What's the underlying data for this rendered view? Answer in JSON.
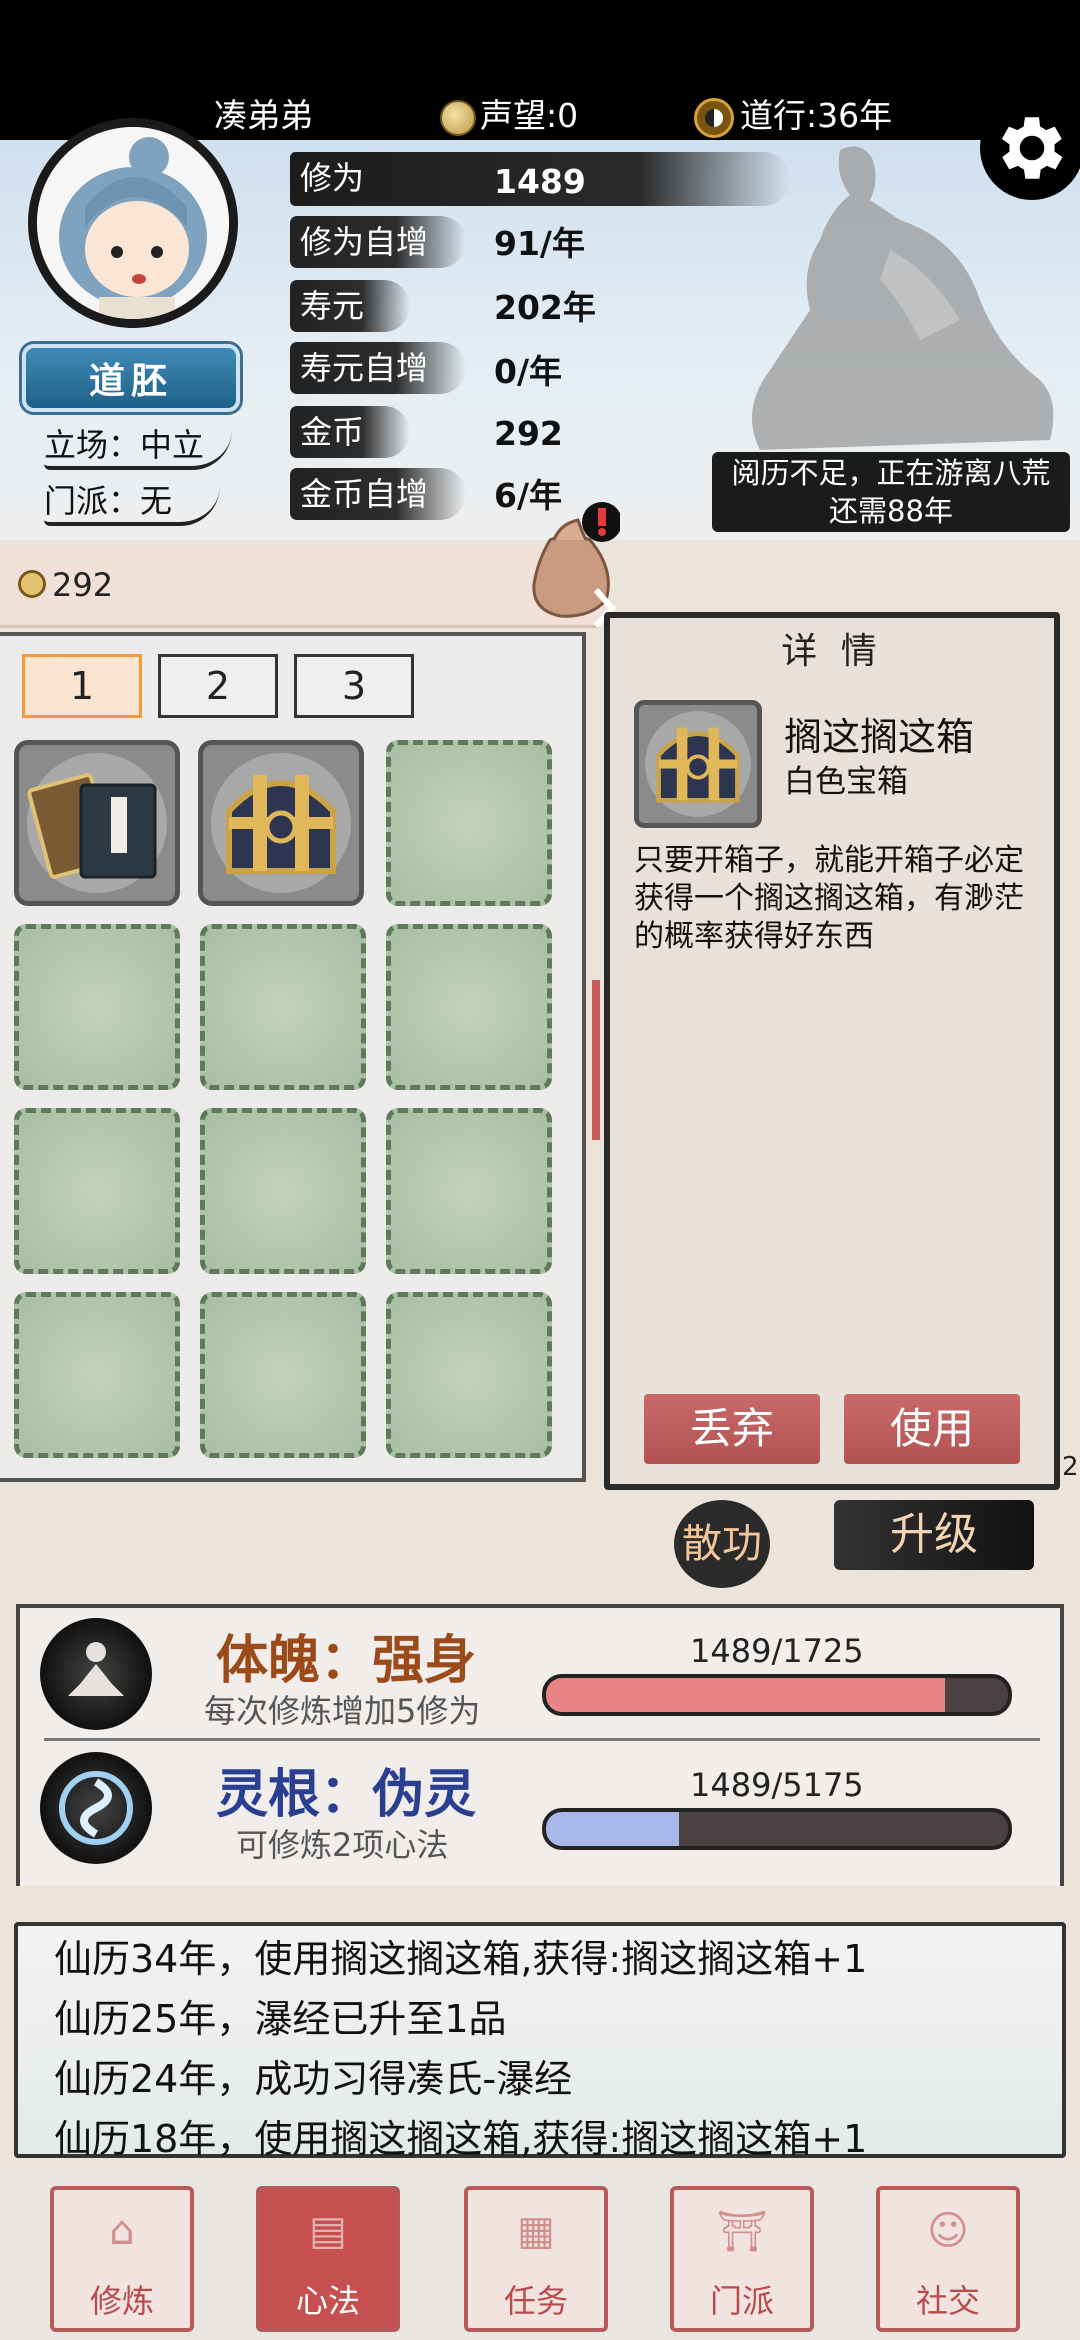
{
  "top_bar": {
    "player_name": "凑弟弟",
    "reputation": "声望:0",
    "dao_xing": "道行:36年"
  },
  "profile": {
    "title_badge": "道胚",
    "stance": "立场：中立",
    "sect": "门派：无"
  },
  "stats": [
    {
      "label": "修为",
      "value": "1489"
    },
    {
      "label": "修为自增",
      "value": "91/年"
    },
    {
      "label": "寿元",
      "value": "202年"
    },
    {
      "label": "寿元自增",
      "value": "0/年"
    },
    {
      "label": "金币",
      "value": "292"
    },
    {
      "label": "金币自增",
      "value": "6/年"
    }
  ],
  "wander_status": {
    "line1": "阅历不足，正在游离八荒",
    "line2": "还需88年"
  },
  "inventory": {
    "money": "292",
    "pages": [
      "1",
      "2",
      "3"
    ],
    "active_page": "1"
  },
  "detail": {
    "title": "详 情",
    "item_name": "搁这搁这箱",
    "item_type": "白色宝箱",
    "description": "只要开箱子，就能开箱子必定获得一个搁这搁这箱，有渺茫的概率获得好东西",
    "discard_label": "丢弃",
    "use_label": "使用"
  },
  "side_number": "2",
  "actions": {
    "disperse_label": "散功",
    "upgrade_label": "升级"
  },
  "cultivation": {
    "body": {
      "title": "体魄：强身",
      "subtitle": "每次修炼增加5修为",
      "progress_text": "1489/1725",
      "progress": 0.863,
      "bar_color": "#e88484"
    },
    "root": {
      "title": "灵根：伪灵",
      "subtitle": "可修炼2项心法",
      "progress_text": "1489/5175",
      "progress": 0.288,
      "bar_color": "#a9b8ea"
    }
  },
  "log": [
    "仙历34年，使用搁这搁这箱,获得:搁这搁这箱+1",
    "仙历25年，瀑经已升至1品",
    "仙历24年，成功习得凑氏-瀑经",
    "仙历18年，使用搁这搁这箱,获得:搁这搁这箱+1"
  ],
  "nav": [
    {
      "label": "修炼",
      "active": false
    },
    {
      "label": "心法",
      "active": true
    },
    {
      "label": "任务",
      "active": false
    },
    {
      "label": "门派",
      "active": false
    },
    {
      "label": "社交",
      "active": false
    }
  ],
  "colors": {
    "accent_red": "#c65050",
    "active_tab_orange": "#f39a3c"
  }
}
